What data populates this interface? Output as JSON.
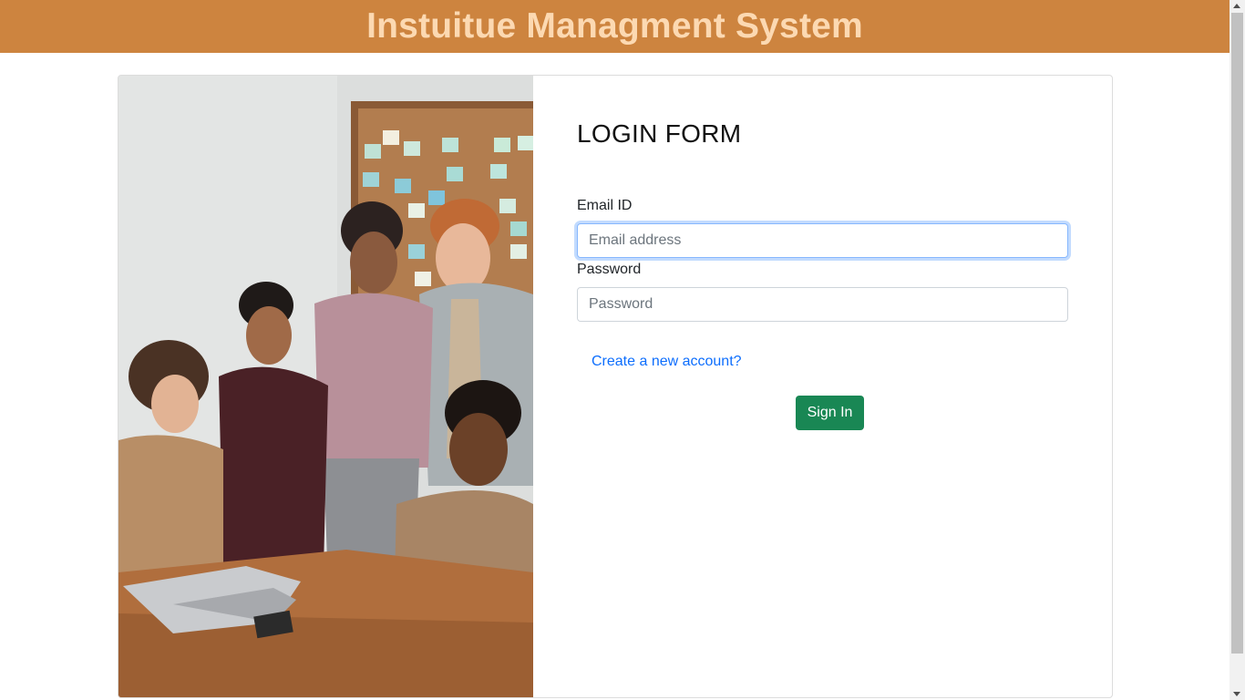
{
  "header": {
    "title": "Instuitue Managment System"
  },
  "login": {
    "title": "LOGIN FORM",
    "email_label": "Email ID",
    "email_placeholder": "Email address",
    "email_value": "",
    "password_label": "Password",
    "password_placeholder": "Password",
    "password_value": "",
    "create_account_link": "Create a new account?",
    "sign_in_label": "Sign In"
  },
  "colors": {
    "header_bg": "#cd843f",
    "header_text": "#fcd9b2",
    "button_bg": "#198754",
    "link": "#0d6efd"
  },
  "images": {
    "team_photo": "people-around-laptop-photo"
  }
}
